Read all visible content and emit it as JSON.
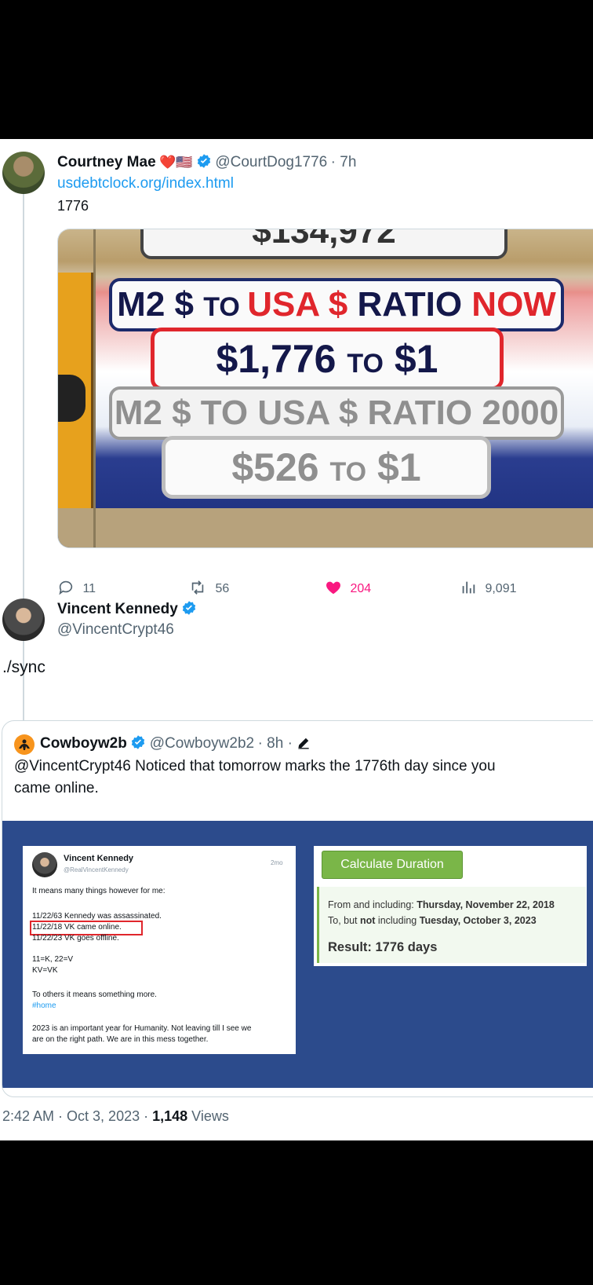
{
  "tweet1": {
    "author_name": "Courtney Mae",
    "emoji": "❤️🇺🇸",
    "handle": "@CourtDog1776",
    "time": "· 7h",
    "link": "usdebtclock.org/index.html",
    "text": "1776",
    "image": {
      "top_partial": "$134,972",
      "row1": [
        "M2 $ ",
        "TO ",
        "USA $",
        " RATIO ",
        "NOW"
      ],
      "row2_value": "$1,776",
      "row2_to": "TO",
      "row2_one": "$1",
      "row3": "M2 $ TO USA $ RATIO 2000",
      "row4_value": "$526",
      "row4_to": "TO",
      "row4_one": "$1"
    },
    "actions": {
      "replies": "11",
      "retweets": "56",
      "likes": "204",
      "views": "9,091"
    }
  },
  "tweet2": {
    "author_name": "Vincent Kennedy",
    "handle": "@VincentCrypt46",
    "text": "./sync",
    "quote": {
      "author_name": "Cowboyw2b",
      "handle": "@Cowboyw2b2",
      "time": "· 8h ·",
      "text_line1": "@VincentCrypt46 Noticed that tomorrow marks the 1776th day since you",
      "text_line2": "came online.",
      "inner_tweet": {
        "name": "Vincent Kennedy",
        "handle": "@RealVincentKennedy",
        "time": "2mo",
        "lines": [
          "It means many things however for me:",
          "11/22/63 Kennedy was assassinated.",
          "11/22/18 VK came online.",
          "11/22/23 VK goes offline.",
          "11=K, 22=V",
          "KV=VK",
          "To others it means something more.",
          "#home",
          "2023 is an important year for Humanity. Not leaving till I see we",
          "are on the right path. We are in this mess together."
        ]
      },
      "calc": {
        "button": "Calculate Duration",
        "from_label": "From and including: ",
        "from_value": "Thursday, November 22, 2018",
        "to_label_a": "To, but ",
        "to_label_not": "not",
        "to_label_b": " including ",
        "to_value": "Tuesday, October 3, 2023",
        "result": "Result: 1776 days"
      }
    },
    "footer": {
      "time": "2:42 AM · Oct 3, 2023 · ",
      "views_count": "1,148",
      "views_label": " Views"
    }
  },
  "colors": {
    "link": "#1d9bf0",
    "like": "#f91880",
    "verified": "#1d9bf0",
    "grey": "#536471",
    "sign_red": "#e0262c",
    "sign_navy": "#1c2a6b",
    "calc_green": "#7ab648",
    "panel_blue": "#2c4b8c"
  }
}
